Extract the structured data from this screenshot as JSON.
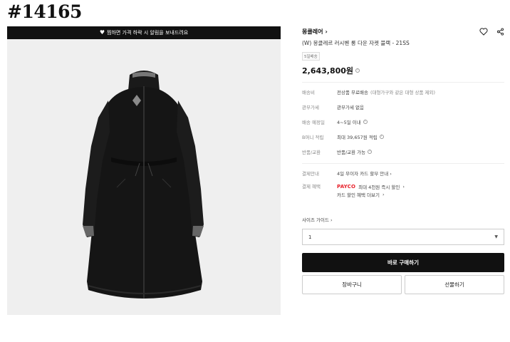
{
  "id_tag": "#14165",
  "image_panel": {
    "banner_text": "찜하면 가격 하락 시 알림을 보내드려요",
    "image_alt": "coat"
  },
  "product": {
    "brand": "몽클레어",
    "title": "(W) 몽클레르 러시벤 롱 다운 자켓 블랙 - 21SS",
    "badge": "5일배송",
    "price": "2,643,800원"
  },
  "info_rows": [
    {
      "key": "배송비",
      "value": "전상품 무료배송",
      "sub": "(대형가구와 같은 대형 상품 제외)"
    },
    {
      "key": "관부가세",
      "value": "관부가세 없음"
    },
    {
      "key": "배송 예정일",
      "value": "4~5일 이내"
    },
    {
      "key": "B머니 적립",
      "value": "최대 39,657원 적립"
    },
    {
      "key": "반품/교환",
      "value": "반품/교환 가능"
    }
  ],
  "payment": {
    "installment_key": "결제안내",
    "installment_value": "4일 무이자 카드 할부 안내",
    "benefit_key": "결제 혜택",
    "payco": "PAYCO",
    "payco_value": "최대 4천원 즉시 할인",
    "card_discount": "카드 할인 혜택 더보기"
  },
  "size_guide": "사이즈 가이드",
  "select": {
    "value": "1"
  },
  "buttons": {
    "buy": "바로 구매하기",
    "cart": "장바구니",
    "gift": "선물하기"
  },
  "colors": {
    "buy_button": "#111111",
    "payco": "#e8202a"
  }
}
